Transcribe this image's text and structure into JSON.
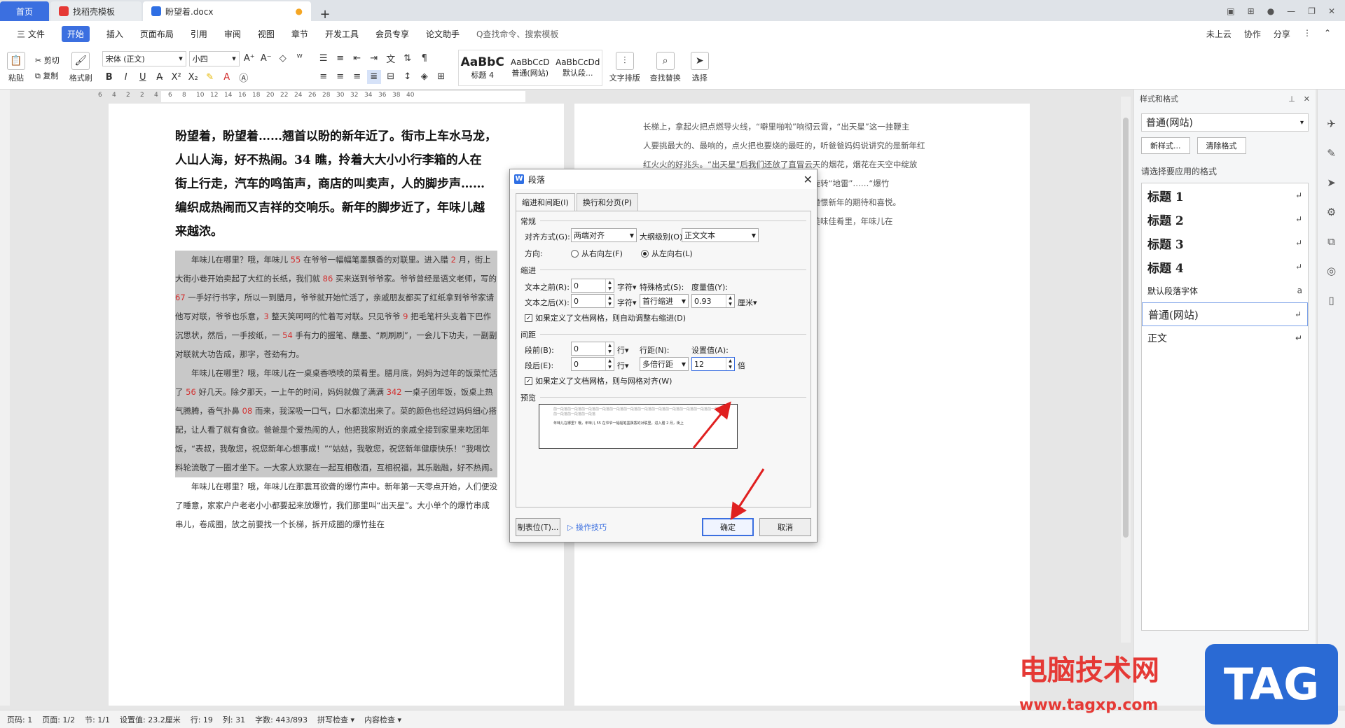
{
  "titlebar": {
    "tabs": [
      {
        "label": "首页"
      },
      {
        "label": "找稻壳模板"
      },
      {
        "label": "盼望着.docx"
      }
    ]
  },
  "menubar": {
    "items": [
      "三 文件",
      "开始",
      "插入",
      "页面布局",
      "引用",
      "审阅",
      "视图",
      "章节",
      "开发工具",
      "会员专享",
      "论文助手"
    ],
    "active": "开始",
    "search": "Q查找命令、搜索模板",
    "right": [
      "未上云",
      "协作",
      "分享"
    ]
  },
  "ribbon": {
    "paste": "粘贴",
    "cut": "剪切",
    "copy": "复制",
    "format_painter": "格式刷",
    "font": "宋体 (正文)",
    "size": "小四",
    "styles": [
      {
        "sample": "AaBbC",
        "name": "标题 4"
      },
      {
        "sample": "AaBbCcD",
        "name": "普通(网站)"
      },
      {
        "sample": "AaBbCcDd",
        "name": "默认段..."
      }
    ],
    "text_layout": "文字排版",
    "find_replace": "查找替换",
    "select": "选择"
  },
  "ruler": {
    "ticks": [
      "6",
      "4",
      "2",
      "2",
      "4",
      "6",
      "8",
      "10",
      "12",
      "14",
      "16",
      "18",
      "20",
      "22",
      "24",
      "26",
      "28",
      "30",
      "32",
      "34",
      "36",
      "38",
      "40"
    ]
  },
  "page1": {
    "title_lines": [
      "盼望着，盼望着……翘首以盼的新年近了。街市上车水马龙，",
      "人山人海，好不热闹。34 瞧，拎着大大小小行李箱的人在",
      "街上行走，汽车的鸣笛声，商店的叫卖声，人的脚步声……",
      "编织成热闹而又吉祥的交响乐。新年的脚步近了，年味儿越",
      "来越浓。"
    ],
    "para1": [
      {
        "t": "　　年味儿在哪里？哦，年味儿 ",
        "r": ""
      },
      {
        "t": "55",
        "r": "red"
      },
      {
        "t": " 在爷爷一幅幅笔墨飘香的对联里。进入腊 ",
        "r": ""
      },
      {
        "t": "2",
        "r": "red"
      },
      {
        "t": " 月，街上大街小巷开始卖起了大红的长纸，我们就 ",
        "r": ""
      },
      {
        "t": "86",
        "r": "red"
      },
      {
        "t": " 买来送到爷爷家。爷爷曾经是语文老师，写的 ",
        "r": ""
      },
      {
        "t": "67",
        "r": "red"
      },
      {
        "t": " 一手好行书字，所以一到腊月，爷爷就开始忙活了，亲戚朋友都买了红纸拿到爷爷家请他写对联，爷爷也乐意，",
        "r": ""
      },
      {
        "t": "3",
        "r": "red"
      },
      {
        "t": " 整天笑呵呵的忙着写对联。只见爷爷 ",
        "r": ""
      },
      {
        "t": "9",
        "r": "red"
      },
      {
        "t": " 把毛笔杆头支着下巴作沉思状，然后，一手按纸，一 ",
        "r": ""
      },
      {
        "t": "54",
        "r": "red"
      },
      {
        "t": " 手有力的握笔、蘸墨、“刷刷刷”，一会儿下功夫，一副副对联就大功告成，那字，苍劲有力。",
        "r": ""
      }
    ],
    "para2": [
      {
        "t": "　　年味儿在哪里？哦，年味儿在一桌桌香喷喷的菜肴里。腊月底，妈妈为过年的饭菜忙活了 ",
        "r": ""
      },
      {
        "t": "56",
        "r": "red"
      },
      {
        "t": " 好几天。除夕那天，一上午的时间，妈妈就做了满满 ",
        "r": ""
      },
      {
        "t": "342",
        "r": "red"
      },
      {
        "t": " 一桌子团年饭，饭桌上热气腾腾，香气扑鼻 ",
        "r": ""
      },
      {
        "t": "08",
        "r": "red"
      },
      {
        "t": " 而来，我深吸一口气，口水都流出来了。菜的颜色也经过妈妈细心搭配，让人看了就有食欲。爸爸是个爱热闹的人，他把我家附近的亲戚全接到家里来吃团年饭，“表叔，我敬您，祝您新年心想事成！”“姑姑，我敬您，祝您新年健康快乐！”我喝饮料轮流敬了一圈才坐下。一大家人欢聚在一起互相敬酒，互相祝福，其乐融融，好不热闹。",
        "r": ""
      }
    ],
    "para3": "　　年味儿在哪里？哦，年味儿在那震耳欲聋的爆竹声中。新年第一天零点开始，人们便没了睡意，家家户户老老小小都要起来放爆竹，我们那里叫“出天星”。大小单个的爆竹串成串儿，卷成圈，放之前要找一个长梯，拆开成圈的爆竹挂在"
  },
  "page2": {
    "lines": [
      "长梯上，拿起火把点燃导火线，“噼里啪啦”响彻云霄，“出天星”这一挂鞭主",
      "人要挑最大的、最响的，点火把也要烧的最旺的，听爸爸妈妈说讲究的是新年红",
      "红火火的好兆头。“出天星”后我们还放了直冒云天的烟花，烟花在天空中绽放",
      "　　　　　　　　　　　　　　　　火树银花、旋转“地雷”……“爆竹",
      "　　　　　　　　　　　　　　　　地的爆竹来憧憬新年的期待和喜悦。",
      "　　　　　　　　　　　　　　　　妈妈准备的美味佳肴里，年味儿在",
      "　　　　　　　　　　　　　　　　我的记忆里。"
    ]
  },
  "sidepanel": {
    "title": "样式和格式",
    "current": "普通(网站)",
    "new_style": "新样式...",
    "clear_format": "清除格式",
    "choose_label": "请选择要应用的格式",
    "items": [
      {
        "label": "标题  1",
        "kind": "heading"
      },
      {
        "label": "标题  2",
        "kind": "heading"
      },
      {
        "label": "标题  3",
        "kind": "heading"
      },
      {
        "label": "标题  4",
        "kind": "heading"
      },
      {
        "label": "默认段落字体",
        "kind": "small"
      },
      {
        "label": "普通(网站)",
        "kind": "selected"
      },
      {
        "label": "正文",
        "kind": "normal"
      }
    ]
  },
  "dialog": {
    "title": "段落",
    "tabs": [
      "缩进和间距(I)",
      "换行和分页(P)"
    ],
    "general": "常规",
    "align_label": "对齐方式(G):",
    "align_value": "两端对齐",
    "outline_label": "大纲级别(O):",
    "outline_value": "正文文本",
    "direction_label": "方向:",
    "rtl": "从右向左(F)",
    "ltr": "从左向右(L)",
    "indent": "缩进",
    "before_text_label": "文本之前(R):",
    "before_text_value": "0",
    "after_text_label": "文本之后(X):",
    "after_text_value": "0",
    "unit_char": "字符▾",
    "special_label": "特殊格式(S):",
    "special_value": "首行缩进",
    "measure_label": "度量值(Y):",
    "measure_value": "0.93",
    "measure_unit": "厘米▾",
    "auto_indent": "如果定义了文档网格，则自动调整右缩进(D)",
    "spacing": "间距",
    "before_label": "段前(B):",
    "before_value": "0",
    "after_label": "段后(E):",
    "after_value": "0",
    "unit_line": "行▾",
    "line_label": "行距(N):",
    "line_value": "多倍行距",
    "set_label": "设置值(A):",
    "set_value": "12",
    "set_unit": "倍",
    "grid_align": "如果定义了文档网格，则与网格对齐(W)",
    "preview": "预览",
    "preview_text_top": "前一段落前一段落前一段落前一段落前一段落前一段落前一段落前一段落前一段落前一段落前一段落前一段落前一段落前一段落前一段落",
    "preview_text_main": "年味儿在哪里？哦，年味儿 55 在爷爷一幅幅笔墨飘香的对联里。进入腊 2 月，街上",
    "tabstops": "制表位(T)...",
    "tips": "操作技巧",
    "ok": "确定",
    "cancel": "取消"
  },
  "statusbar": {
    "items": [
      "页码: 1",
      "页面: 1/2",
      "节: 1/1",
      "设置值: 23.2厘米",
      "行: 19",
      "列: 31",
      "字数: 443/893",
      "拼写检查 ▾",
      "内容检查 ▾"
    ]
  },
  "watermark": {
    "site_cn": "电脑技术网",
    "site_url": "www.tagxp.com",
    "badge": "TAG"
  }
}
